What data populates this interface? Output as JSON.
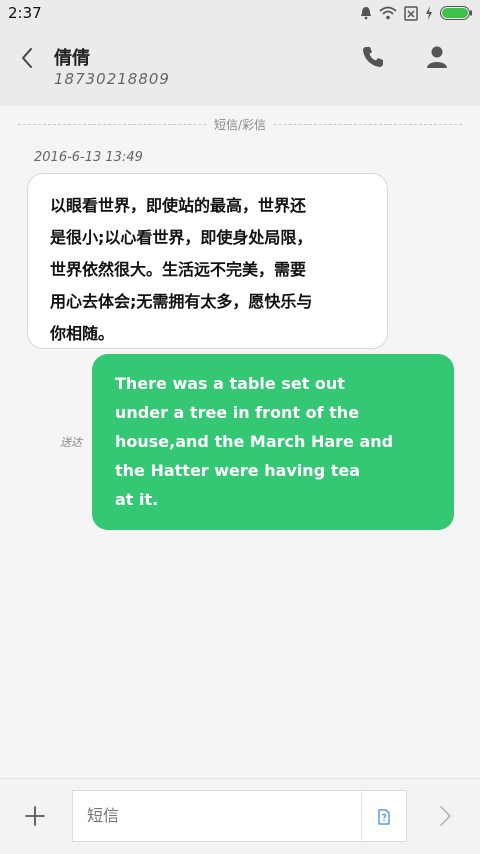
{
  "status_bar": {
    "time": "2:37",
    "icons": [
      "bell-icon",
      "wifi-icon",
      "sim-off-icon",
      "charging-icon",
      "battery-icon"
    ],
    "battery_color": "#3cc24a"
  },
  "header": {
    "contact_name": "倩倩",
    "phone_number": "18730218809",
    "icons": [
      "back-arrow-icon",
      "phone-icon",
      "person-icon"
    ]
  },
  "conversation": {
    "divider_label": "短信/彩信",
    "timestamp": "2016-6-13 13:49",
    "messages": [
      {
        "direction": "incoming",
        "lines": [
          "以眼看世界，即使站的最高，世界还",
          "是很小;以心看世界，即使身处局限，",
          "世界依然很大。生活远不完美，需要",
          "用心去体会;无需拥有太多，愿快乐与",
          "你相随。"
        ],
        "bubble_color": "#ffffff"
      },
      {
        "direction": "outgoing",
        "status": "送达",
        "lines": [
          "There was a table set out",
          "under a tree in front of the",
          "house,and the March Hare and",
          "the Hatter were having tea",
          "at it."
        ],
        "bubble_color": "#34c774"
      }
    ]
  },
  "input_bar": {
    "placeholder": "短信",
    "icons": [
      "plus-icon",
      "sim-card-icon",
      "send-arrow-icon"
    ]
  }
}
